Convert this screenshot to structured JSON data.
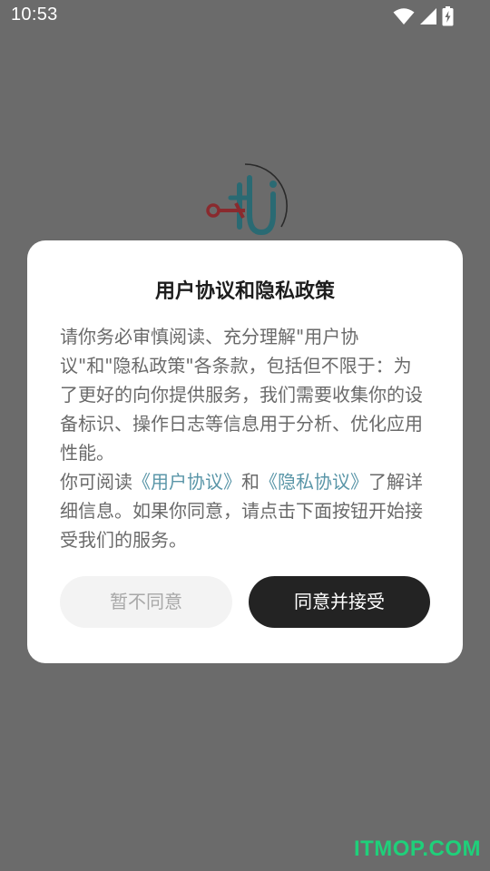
{
  "status_bar": {
    "time": "10:53",
    "icons": [
      "wifi-icon",
      "signal-icon",
      "battery-charging-icon"
    ]
  },
  "app": {
    "logo_icon": "app-logo-icon"
  },
  "dialog": {
    "title": "用户协议和隐私政策",
    "paragraph1": "请你务必审慎阅读、充分理解\"用户协议\"和\"隐私政策\"各条款，包括但不限于：为了更好的向你提供服务，我们需要收集你的设备标识、操作日志等信息用于分析、优化应用性能。",
    "paragraph2_prefix": "你可阅读",
    "link_user_agreement": "《用户协议》",
    "paragraph2_and": "和",
    "link_privacy_policy": "《隐私协议》",
    "paragraph2_suffix": "了解详细信息。如果你同意，请点击下面按钮开始接受我们的服务。",
    "decline_label": "暂不同意",
    "accept_label": "同意并接受"
  },
  "watermark": "ITMOP.COM",
  "colors": {
    "scrim_background": "#6b6b6b",
    "link": "#5a96a8",
    "accept_button": "#232323",
    "decline_button": "#f3f3f3",
    "watermark": "#1fd07a"
  }
}
